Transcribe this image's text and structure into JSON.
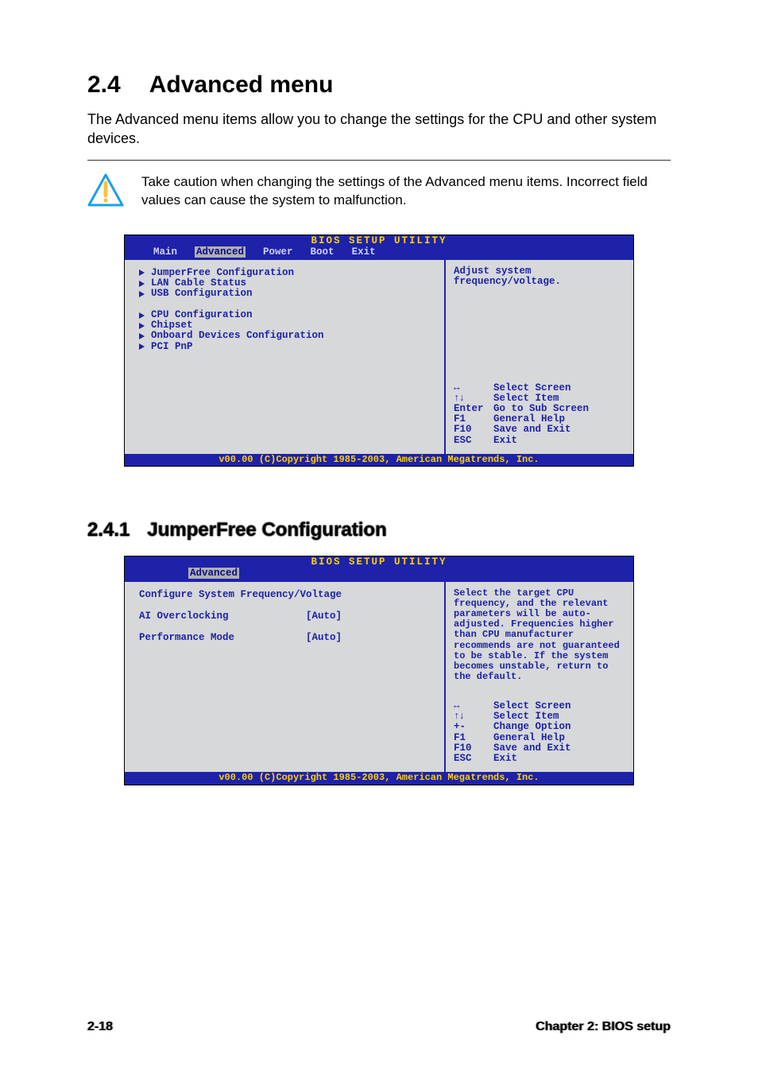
{
  "section": {
    "number": "2.4",
    "title": "Advanced menu",
    "intro": "The Advanced menu items allow you to change the settings for the CPU and other system devices.",
    "caution": "Take caution when changing the settings of the Advanced menu items. Incorrect field values can cause the system to malfunction."
  },
  "bios1": {
    "title": "BIOS SETUP UTILITY",
    "tabs": [
      "Main",
      "Advanced",
      "Power",
      "Boot",
      "Exit"
    ],
    "active_tab": "Advanced",
    "items_group1": [
      "JumperFree Configuration",
      "LAN Cable Status",
      "USB Configuration"
    ],
    "items_group2": [
      "CPU Configuration",
      "Chipset",
      "Onboard Devices Configuration",
      "PCI PnP"
    ],
    "help": "Adjust system frequency/voltage.",
    "keys": [
      {
        "k": "↔",
        "d": "Select Screen"
      },
      {
        "k": "↑↓",
        "d": "Select Item"
      },
      {
        "k": "Enter",
        "d": "Go to Sub Screen"
      },
      {
        "k": "F1",
        "d": "General Help"
      },
      {
        "k": "F10",
        "d": "Save and Exit"
      },
      {
        "k": "ESC",
        "d": "Exit"
      }
    ],
    "footer": "v00.00 (C)Copyright 1985-2003, American Megatrends, Inc."
  },
  "subsection": {
    "number": "2.4.1",
    "title": "JumperFree Configuration"
  },
  "bios2": {
    "title": "BIOS SETUP UTILITY",
    "active_tab": "Advanced",
    "header": "Configure System Frequency/Voltage",
    "options": [
      {
        "label": "AI Overclocking",
        "value": "[Auto]"
      },
      {
        "label": "Performance Mode",
        "value": "[Auto]"
      }
    ],
    "help": "Select the target CPU frequency, and the relevant parameters will be auto-adjusted. Frequencies higher than CPU manufacturer recommends are not guaranteed to be stable. If the system becomes unstable, return to the default.",
    "keys": [
      {
        "k": "↔",
        "d": "Select Screen"
      },
      {
        "k": "↑↓",
        "d": "Select Item"
      },
      {
        "k": "+-",
        "d": "Change Option"
      },
      {
        "k": "F1",
        "d": "General Help"
      },
      {
        "k": "F10",
        "d": "Save and Exit"
      },
      {
        "k": "ESC",
        "d": "Exit"
      }
    ],
    "footer": "v00.00 (C)Copyright 1985-2003, American Megatrends, Inc."
  },
  "page_footer": {
    "left": "2-18",
    "right": "Chapter 2: BIOS setup"
  }
}
